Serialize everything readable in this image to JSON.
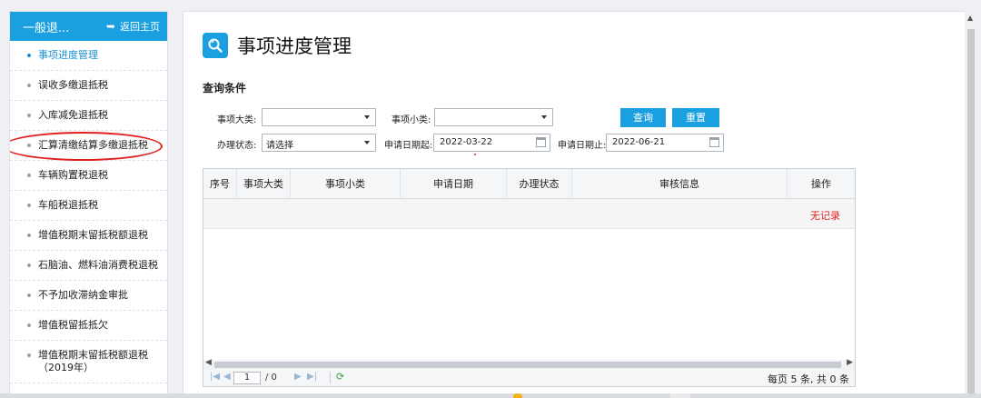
{
  "sidebar": {
    "title": "一般退...",
    "back_label": "返回主页",
    "items": [
      {
        "label": "事项进度管理"
      },
      {
        "label": "误收多缴退抵税"
      },
      {
        "label": "入库减免退抵税"
      },
      {
        "label": "汇算清缴结算多缴退抵税"
      },
      {
        "label": "车辆购置税退税"
      },
      {
        "label": "车船税退抵税"
      },
      {
        "label": "增值税期末留抵税额退税"
      },
      {
        "label": "石脑油、燃料油消费税退税"
      },
      {
        "label": "不予加收滞纳金审批"
      },
      {
        "label": "增值税留抵抵欠"
      },
      {
        "label": "增值税期末留抵税额退税（2019年）"
      }
    ]
  },
  "page": {
    "title": "事项进度管理",
    "section_label": "查询条件"
  },
  "form": {
    "category_label": "事项大类:",
    "category_value": "",
    "subcategory_label": "事项小类:",
    "subcategory_value": "",
    "status_label": "办理状态:",
    "status_value": "请选择",
    "date_from_label": "申请日期起:",
    "date_from_value": "2022-03-22",
    "date_to_label": "申请日期止:",
    "date_to_value": "2022-06-21",
    "query_button": "查询",
    "reset_button": "重置"
  },
  "table": {
    "columns": [
      "序号",
      "事项大类",
      "事项小类",
      "申请日期",
      "办理状态",
      "审核信息",
      "操作"
    ],
    "empty_text": "无记录"
  },
  "pager": {
    "current_page": "1",
    "total_pages": "/ 0",
    "info": "每页 5 条, 共 0 条"
  },
  "colors": {
    "accent": "#1a9fe0",
    "highlight": "#e0201e"
  },
  "icons": {
    "back": "back-arrow-icon",
    "title": "search-icon",
    "calendar": "calendar-icon",
    "refresh": "refresh-icon"
  }
}
